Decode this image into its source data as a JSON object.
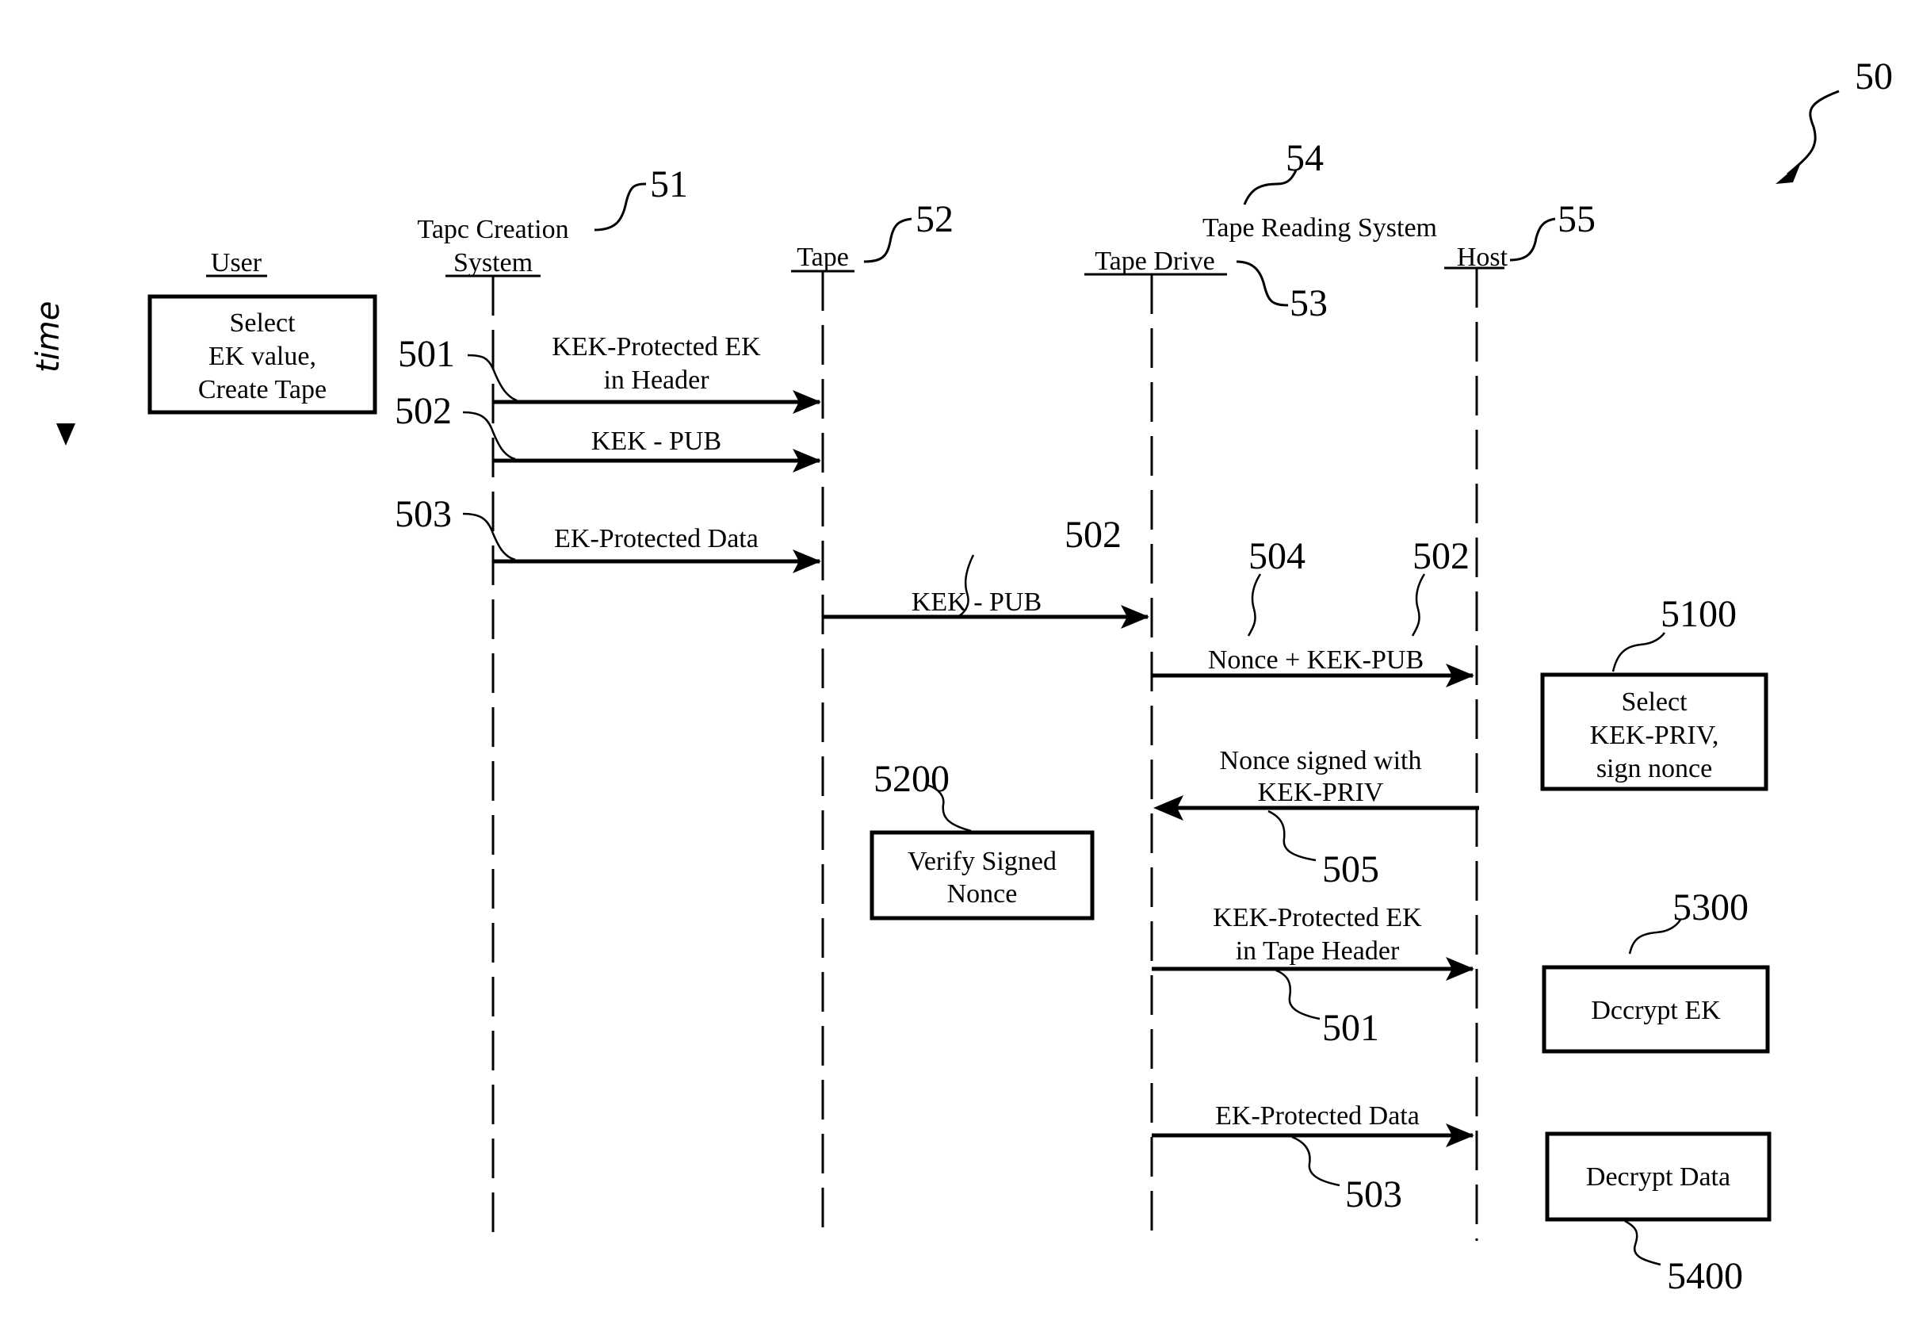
{
  "figure": {
    "figure_ref": "50",
    "time_label": "time"
  },
  "participants": [
    {
      "id": "user",
      "label": "User",
      "ref": ""
    },
    {
      "id": "tcs",
      "label_line1": "Tapc Creation",
      "label_line2": "System",
      "ref": "51"
    },
    {
      "id": "tape",
      "label": "Tape",
      "ref": "52"
    },
    {
      "id": "drive",
      "label": "Tape Drive",
      "ref": "53"
    },
    {
      "id": "host",
      "label": "Host",
      "ref": "55"
    }
  ],
  "group": {
    "label": "Tape Reading System",
    "ref": "54"
  },
  "messages": [
    {
      "ref": "501",
      "from": "tcs",
      "to": "tape",
      "line1": "KEK-Protected EK",
      "line2": "in Header"
    },
    {
      "ref": "502",
      "from": "tcs",
      "to": "tape",
      "line1": "KEK - PUB",
      "line2": ""
    },
    {
      "ref": "503",
      "from": "tcs",
      "to": "tape",
      "line1": "EK-Protected Data",
      "line2": ""
    },
    {
      "ref": "502",
      "from": "tape",
      "to": "drive",
      "line1": "KEK - PUB",
      "line2": ""
    },
    {
      "ref": "504",
      "ref2": "502",
      "from": "drive",
      "to": "host",
      "line1": "Nonce + KEK-PUB",
      "line2": ""
    },
    {
      "ref": "505",
      "from": "host",
      "to": "drive",
      "line1": "Nonce signed with",
      "line2": "KEK-PRIV"
    },
    {
      "ref": "501",
      "from": "drive",
      "to": "host",
      "line1": "KEK-Protected EK",
      "line2": "in Tape Header"
    },
    {
      "ref": "503",
      "from": "drive",
      "to": "host",
      "line1": "EK-Protected Data",
      "line2": ""
    }
  ],
  "actions": [
    {
      "id": "user-action",
      "ref": "",
      "lines": [
        "Select",
        "EK value,",
        "Create Tape"
      ]
    },
    {
      "id": "5100",
      "ref": "5100",
      "lines": [
        "Select",
        "KEK-PRIV,",
        "sign nonce"
      ]
    },
    {
      "id": "5200",
      "ref": "5200",
      "lines": [
        "Verify Signed",
        "Nonce"
      ]
    },
    {
      "id": "5300",
      "ref": "5300",
      "lines": [
        "Dccrypt EK"
      ]
    },
    {
      "id": "5400",
      "ref": "5400",
      "lines": [
        "Decrypt Data"
      ]
    }
  ]
}
